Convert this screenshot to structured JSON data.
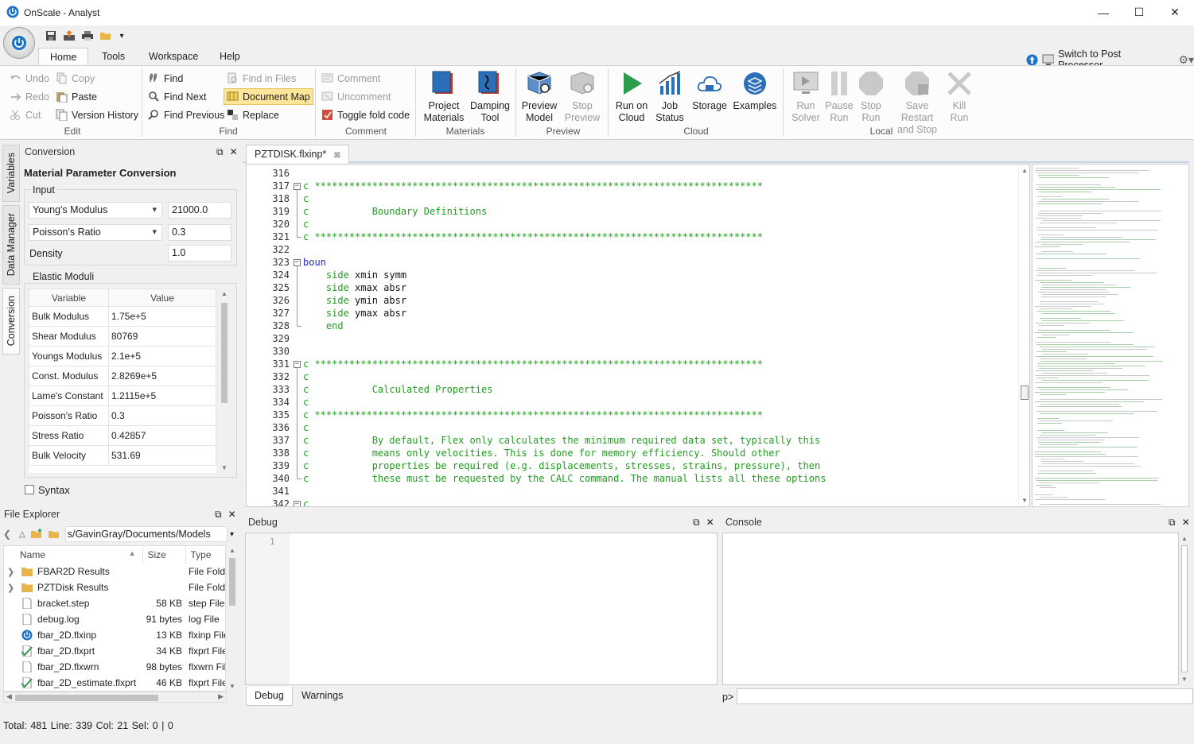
{
  "app": {
    "title": "OnScale - Analyst"
  },
  "window": {
    "minimize": "—",
    "maximize": "☐",
    "close": "✕"
  },
  "ribbon_tabs": [
    "Home",
    "Tools",
    "Workspace",
    "Help"
  ],
  "switch_label": "Switch to Post Processor",
  "groups": {
    "edit": {
      "label": "Edit",
      "undo": "Undo",
      "redo": "Redo",
      "cut": "Cut",
      "copy": "Copy",
      "paste": "Paste",
      "version_history": "Version History"
    },
    "find": {
      "label": "Find",
      "find": "Find",
      "find_next": "Find Next",
      "find_previous": "Find Previous",
      "find_in_files": "Find in Files",
      "document_map": "Document Map",
      "replace": "Replace"
    },
    "comment": {
      "label": "Comment",
      "comment": "Comment",
      "uncomment": "Uncomment",
      "toggle_fold": "Toggle fold code"
    },
    "materials": {
      "label": "Materials",
      "project_materials": [
        "Project",
        "Materials"
      ],
      "damping_tool": [
        "Damping",
        "Tool"
      ]
    },
    "preview": {
      "label": "Preview",
      "preview_model": [
        "Preview",
        "Model"
      ],
      "stop_preview": [
        "Stop",
        "Preview"
      ]
    },
    "cloud": {
      "label": "Cloud",
      "run_on_cloud": [
        "Run on",
        "Cloud"
      ],
      "job_status": [
        "Job",
        "Status"
      ],
      "storage": "Storage",
      "examples": "Examples"
    },
    "local": {
      "label": "Local",
      "run_solver": [
        "Run",
        "Solver"
      ],
      "pause_run": [
        "Pause",
        "Run"
      ],
      "stop_run": [
        "Stop",
        "Run"
      ],
      "save_restart": [
        "Save Restart",
        "and Stop"
      ],
      "kill_run": [
        "Kill",
        "Run"
      ]
    }
  },
  "side_tabs": [
    "Variables",
    "Data Manager",
    "Conversion"
  ],
  "conversion": {
    "panel_title": "Conversion",
    "heading": "Material Parameter Conversion",
    "input_label": "Input",
    "inputs": [
      {
        "name": "Young's Modulus",
        "value": "21000.0"
      },
      {
        "name": "Poisson's Ratio",
        "value": "0.3"
      },
      {
        "name": "Density",
        "value": "1.0"
      }
    ],
    "moduli_label": "Elastic Moduli",
    "columns": [
      "Variable",
      "Value"
    ],
    "rows": [
      [
        "Bulk Modulus",
        "1.75e+5"
      ],
      [
        "Shear Modulus",
        "80769"
      ],
      [
        "Youngs Modulus",
        "2.1e+5"
      ],
      [
        "Const. Modulus",
        "2.8269e+5"
      ],
      [
        "Lame's Constant",
        "1.2115e+5"
      ],
      [
        "Poisson's Ratio",
        "0.3"
      ],
      [
        "Stress Ratio",
        "0.42857"
      ],
      [
        "Bulk Velocity",
        "531.69"
      ]
    ],
    "syntax_label": "Syntax"
  },
  "file_explorer": {
    "title": "File Explorer",
    "path": "s/GavinGray/Documents/Models",
    "columns": [
      "Name",
      "Size",
      "Type"
    ],
    "files": [
      {
        "name": "FBAR2D Results",
        "size": "",
        "type": "File Folde",
        "icon": "folder-icon",
        "expand": true
      },
      {
        "name": "PZTDisk Results",
        "size": "",
        "type": "File Folde",
        "icon": "folder-icon",
        "expand": true
      },
      {
        "name": "bracket.step",
        "size": "58 KB",
        "type": "step File",
        "icon": "file-icon",
        "expand": false
      },
      {
        "name": "debug.log",
        "size": "91 bytes",
        "type": "log File",
        "icon": "file-icon",
        "expand": false
      },
      {
        "name": "fbar_2D.flxinp",
        "size": "13 KB",
        "type": "flxinp File",
        "icon": "onscale-icon",
        "expand": false
      },
      {
        "name": "fbar_2D.flxprt",
        "size": "34 KB",
        "type": "flxprt File",
        "icon": "flxprt-icon",
        "expand": false
      },
      {
        "name": "fbar_2D.flxwrn",
        "size": "98 bytes",
        "type": "flxwrn Fil",
        "icon": "file-icon",
        "expand": false
      },
      {
        "name": "fbar_2D_estimate.flxprt",
        "size": "46 KB",
        "type": "flxprt File",
        "icon": "flxprt-icon",
        "expand": false
      }
    ]
  },
  "editor": {
    "tab": "PZTDISK.flxinp*",
    "lines": [
      {
        "n": "316",
        "t": "",
        "c": "cmt"
      },
      {
        "n": "317",
        "t": "c ******************************************************************************",
        "c": "cmt"
      },
      {
        "n": "318",
        "t": "c",
        "c": "cmt"
      },
      {
        "n": "319",
        "t": "c           Boundary Definitions",
        "c": "cmt"
      },
      {
        "n": "320",
        "t": "c",
        "c": "cmt"
      },
      {
        "n": "321",
        "t": "c ******************************************************************************",
        "c": "cmt"
      },
      {
        "n": "322",
        "t": "",
        "c": "cmt"
      },
      {
        "n": "323",
        "t": "boun",
        "c": "kw"
      },
      {
        "n": "324",
        "t": "    side xmin symm",
        "c": "mix"
      },
      {
        "n": "325",
        "t": "    side xmax absr",
        "c": "mix"
      },
      {
        "n": "326",
        "t": "    side ymin absr",
        "c": "mix"
      },
      {
        "n": "327",
        "t": "    side ymax absr",
        "c": "mix"
      },
      {
        "n": "328",
        "t": "    end",
        "c": "cmt"
      },
      {
        "n": "329",
        "t": "",
        "c": "cmt"
      },
      {
        "n": "330",
        "t": "",
        "c": "cmt"
      },
      {
        "n": "331",
        "t": "c ******************************************************************************",
        "c": "cmt"
      },
      {
        "n": "332",
        "t": "c",
        "c": "cmt"
      },
      {
        "n": "333",
        "t": "c           Calculated Properties",
        "c": "cmt"
      },
      {
        "n": "334",
        "t": "c",
        "c": "cmt"
      },
      {
        "n": "335",
        "t": "c ******************************************************************************",
        "c": "cmt"
      },
      {
        "n": "336",
        "t": "c",
        "c": "cmt"
      },
      {
        "n": "337",
        "t": "c           By default, Flex only calculates the minimum required data set, typically this",
        "c": "cmt"
      },
      {
        "n": "338",
        "t": "c           means only velocities. This is done for memory efficiency. Should other",
        "c": "cmt"
      },
      {
        "n": "339",
        "t": "c           properties be required (e.g. displacements, stresses, strains, pressure), then",
        "c": "cmt"
      },
      {
        "n": "340",
        "t": "c           these must be requested by the CALC command. The manual lists all these options",
        "c": "cmt"
      },
      {
        "n": "341",
        "t": "",
        "c": "cmt"
      },
      {
        "n": "342",
        "t": "c",
        "c": "cmt"
      }
    ]
  },
  "debug": {
    "title": "Debug",
    "line": "1",
    "tabs": [
      "Debug",
      "Warnings"
    ]
  },
  "console": {
    "title": "Console",
    "prompt": "p>"
  },
  "status": "Total: 481  Line: 339  Col: 21  Sel: 0 | 0",
  "colors": {
    "accent": "#0078d7",
    "comment": "#1f9d1f",
    "keyword": "#1f1fbf",
    "highlight": "#fde59a"
  }
}
